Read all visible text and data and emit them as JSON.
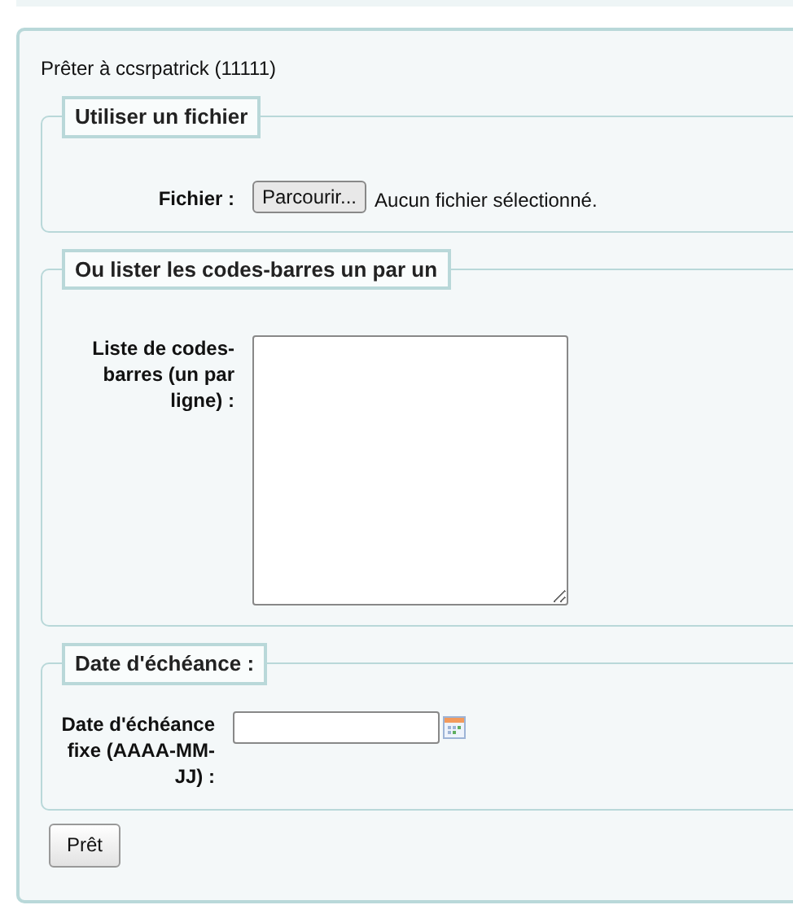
{
  "title": "Prêter à ccsrpatrick (11111)",
  "sections": [
    {
      "kind": "file",
      "legend": "Utiliser un fichier",
      "label": "Fichier :",
      "button": "Parcourir...",
      "status": "Aucun fichier sélectionné."
    },
    {
      "kind": "textarea",
      "legend": "Ou lister les codes-barres un par un",
      "label": "Liste de codes-barres (un par ligne) :"
    },
    {
      "kind": "date",
      "legend": "Date d'échéance :",
      "label": "Date d'échéance fixe (AAAA-MM-JJ) :"
    }
  ],
  "submit": "Prêt"
}
